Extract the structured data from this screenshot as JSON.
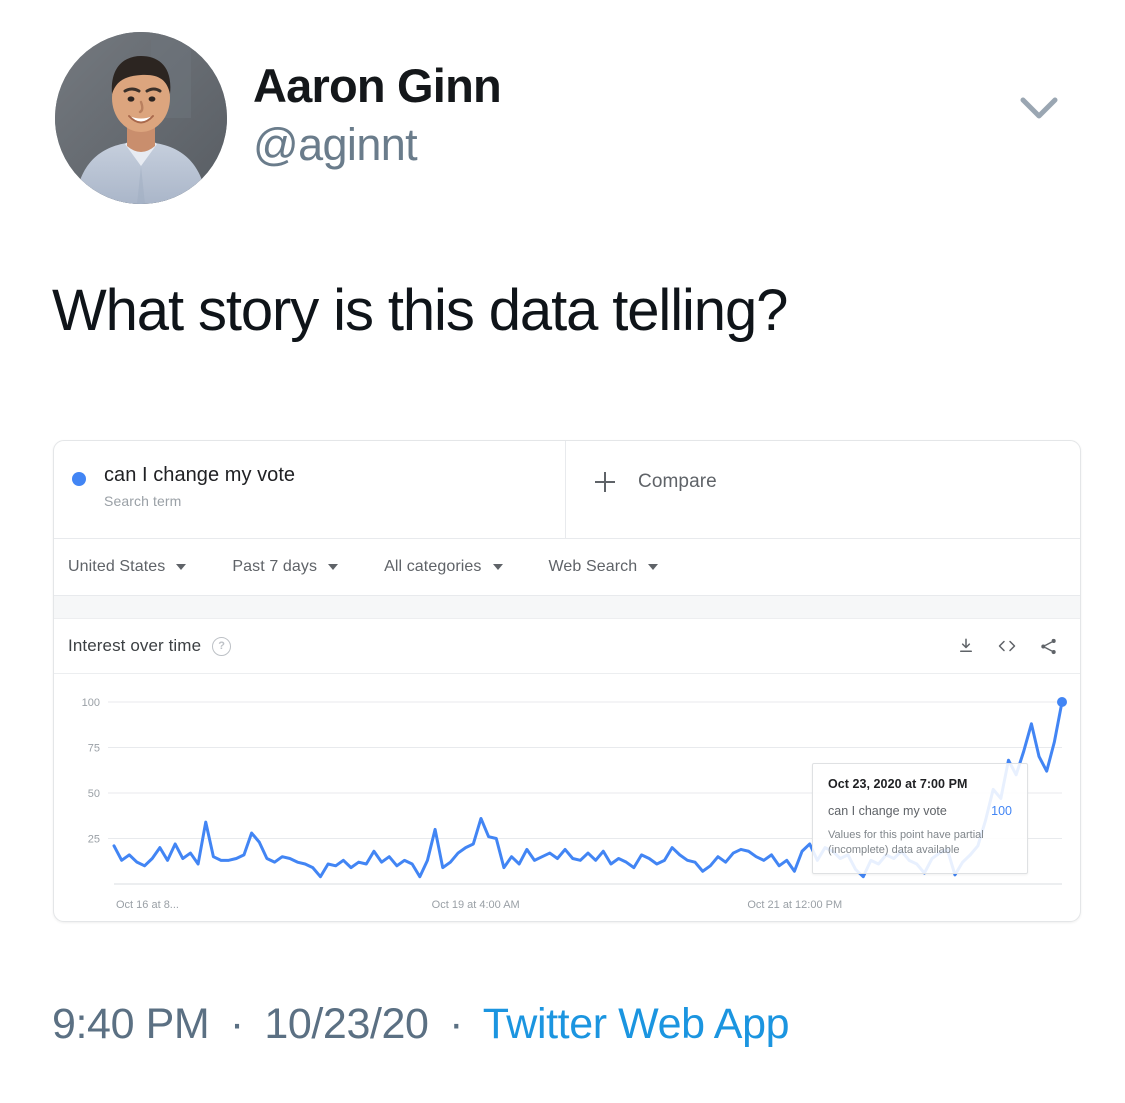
{
  "tweet": {
    "display_name": "Aaron Ginn",
    "handle": "@aginnt",
    "text": "What story is this data telling?",
    "time": "9:40 PM",
    "date": "10/23/20",
    "source": "Twitter Web App",
    "separator": "·",
    "caret_icon": "chevron-down-icon",
    "avatar_icon": "avatar"
  },
  "trends": {
    "term": {
      "label": "can I change my vote",
      "sublabel": "Search term",
      "dot_color": "#4285f4"
    },
    "compare": {
      "label": "Compare",
      "icon": "plus-icon"
    },
    "filters": [
      {
        "label": "United States"
      },
      {
        "label": "Past 7 days"
      },
      {
        "label": "All categories"
      },
      {
        "label": "Web Search"
      }
    ],
    "panel": {
      "title": "Interest over time",
      "help_icon": "help-circle-icon",
      "actions": [
        {
          "name": "download-icon"
        },
        {
          "name": "embed-code-icon"
        },
        {
          "name": "share-icon"
        }
      ]
    },
    "tooltip": {
      "date": "Oct 23, 2020 at 7:00 PM",
      "series_name": "can I change my vote",
      "value": "100",
      "note": "Values for this point have partial (incomplete) data available"
    }
  },
  "chart_data": {
    "type": "line",
    "title": "Interest over time",
    "subtitle": "can I change my vote — Search term",
    "xlabel": "",
    "ylabel": "",
    "ylim": [
      0,
      100
    ],
    "yticks": [
      25,
      50,
      75,
      100
    ],
    "ytick_labels": [
      "25",
      "50",
      "75",
      "100"
    ],
    "xtick_labels": [
      "Oct 16 at 8...",
      "Oct 19 at 4:00 AM",
      "Oct 21 at 12:00 PM"
    ],
    "xtick_positions": [
      0,
      0.333,
      0.666
    ],
    "grid": true,
    "legend": false,
    "line_color": "#4285f4",
    "region": "United States",
    "period": "Past 7 days",
    "category": "All categories",
    "search_type": "Web Search",
    "annotation": {
      "x_label": "Oct 23, 2020 at 7:00 PM",
      "value": 100,
      "note": "Values for this point have partial (incomplete) data available"
    },
    "series": [
      {
        "name": "can I change my vote",
        "values": [
          21,
          13,
          16,
          12,
          10,
          14,
          20,
          13,
          22,
          14,
          17,
          11,
          34,
          15,
          13,
          13,
          14,
          16,
          28,
          23,
          14,
          12,
          15,
          14,
          12,
          11,
          9,
          4,
          11,
          10,
          13,
          9,
          12,
          11,
          18,
          12,
          15,
          10,
          13,
          11,
          4,
          13,
          30,
          9,
          12,
          17,
          20,
          22,
          36,
          26,
          25,
          9,
          15,
          11,
          19,
          13,
          15,
          17,
          14,
          19,
          14,
          13,
          17,
          13,
          18,
          11,
          14,
          12,
          9,
          16,
          14,
          11,
          13,
          20,
          16,
          13,
          12,
          7,
          10,
          15,
          12,
          17,
          19,
          18,
          15,
          13,
          16,
          10,
          13,
          7,
          18,
          22,
          13,
          20,
          18,
          14,
          16,
          8,
          4,
          13,
          11,
          16,
          14,
          18,
          13,
          11,
          6,
          14,
          17,
          19,
          5,
          12,
          16,
          21,
          35,
          52,
          47,
          68,
          60,
          73,
          88,
          70,
          62,
          78,
          100
        ]
      }
    ]
  }
}
